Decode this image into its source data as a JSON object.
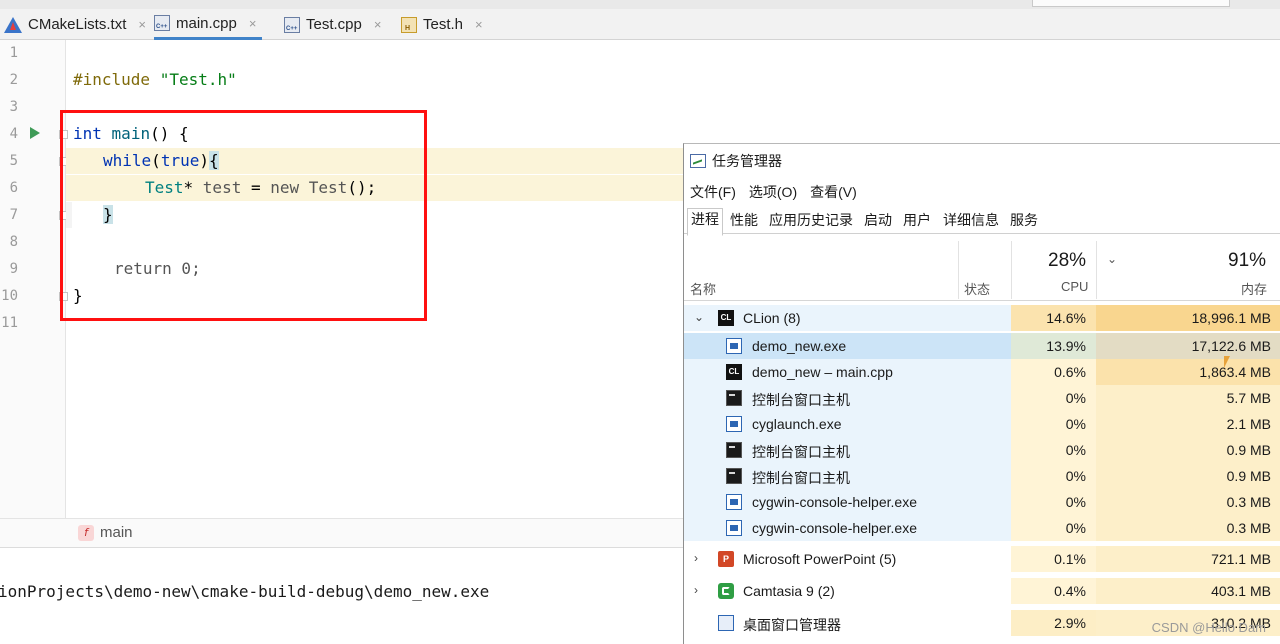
{
  "ide": {
    "tabs": [
      {
        "label": "CMakeLists.txt",
        "icon": "cmake-icon"
      },
      {
        "label": "main.cpp",
        "icon": "cpp-file-icon",
        "active": true
      },
      {
        "label": "Test.cpp",
        "icon": "cpp-file-icon"
      },
      {
        "label": "Test.h",
        "icon": "header-file-icon"
      }
    ],
    "tab_close": "×",
    "line_numbers": [
      "1",
      "2",
      "3",
      "4",
      "5",
      "6",
      "7",
      "8",
      "9",
      "10",
      "11"
    ],
    "code": {
      "l2_directive": "#include",
      "l2_file": "\"Test.h\"",
      "l4_type": "int",
      "l4_fn": "main",
      "l4_rest": "() {",
      "l5_kw": "while",
      "l5_open": "(",
      "l5_val": "true",
      "l5_close": ")",
      "l5_brace": "{",
      "l6_cls": "Test",
      "l6_star": "* ",
      "l6_var": "test",
      "l6_eq": " = ",
      "l6_new": "new",
      "l6_cls2": " Test",
      "l6_end": "();",
      "l7_brace": "}",
      "l9_kw": "return",
      "l9_num": " 0",
      "l9_semi": ";",
      "l10_brace": "}"
    },
    "breadcrumb": {
      "badge": "f",
      "label": "main"
    },
    "run_output": "ionProjects\\demo-new\\cmake-build-debug\\demo_new.exe",
    "highlight_color": "#fbf4d9",
    "annotation_color": "#ff1010"
  },
  "task_manager": {
    "title": "任务管理器",
    "menu": [
      "文件(F)",
      "选项(O)",
      "查看(V)"
    ],
    "tabs": [
      "进程",
      "性能",
      "应用历史记录",
      "启动",
      "用户",
      "详细信息",
      "服务"
    ],
    "active_tab": "进程",
    "columns": {
      "name": "名称",
      "status": "状态",
      "cpu_pct": "28%",
      "cpu": "CPU",
      "mem_pct": "91%",
      "mem": "内存"
    },
    "rows": [
      {
        "name": "CLion (8)",
        "icon": "clion-icon",
        "cpu": "14.6%",
        "mem": "18,996.1 MB",
        "expander": "⌄",
        "level": 0
      },
      {
        "name": "demo_new.exe",
        "icon": "app-window-icon",
        "cpu": "13.9%",
        "mem": "17,122.6 MB",
        "level": 1,
        "selected": true
      },
      {
        "name": "demo_new – main.cpp",
        "icon": "clion-icon",
        "cpu": "0.6%",
        "mem": "1,863.4 MB",
        "level": 1
      },
      {
        "name": "控制台窗口主机",
        "icon": "console-icon",
        "cpu": "0%",
        "mem": "5.7 MB",
        "level": 1
      },
      {
        "name": "cyglaunch.exe",
        "icon": "app-window-icon",
        "cpu": "0%",
        "mem": "2.1 MB",
        "level": 1
      },
      {
        "name": "控制台窗口主机",
        "icon": "console-icon",
        "cpu": "0%",
        "mem": "0.9 MB",
        "level": 1
      },
      {
        "name": "控制台窗口主机",
        "icon": "console-icon",
        "cpu": "0%",
        "mem": "0.9 MB",
        "level": 1
      },
      {
        "name": "cygwin-console-helper.exe",
        "icon": "app-window-icon",
        "cpu": "0%",
        "mem": "0.3 MB",
        "level": 1
      },
      {
        "name": "cygwin-console-helper.exe",
        "icon": "app-window-icon",
        "cpu": "0%",
        "mem": "0.3 MB",
        "level": 1
      },
      {
        "name": "Microsoft PowerPoint (5)",
        "icon": "powerpoint-icon",
        "cpu": "0.1%",
        "mem": "721.1 MB",
        "expander": "›",
        "level": 0
      },
      {
        "name": "Camtasia 9 (2)",
        "icon": "camtasia-icon",
        "cpu": "0.4%",
        "mem": "403.1 MB",
        "expander": "›",
        "level": 0
      },
      {
        "name": "桌面窗口管理器",
        "icon": "window-manager-icon",
        "cpu": "2.9%",
        "mem": "310.2 MB",
        "level": 0
      }
    ]
  },
  "watermark": "CSDN @Hello Dam"
}
